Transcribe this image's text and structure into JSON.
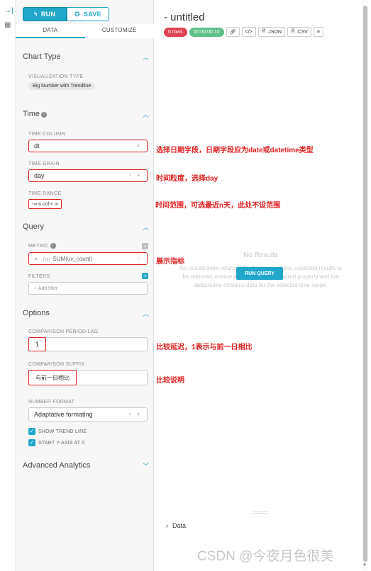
{
  "rail": {
    "collapse_icon": "→|",
    "grid_icon": "▦"
  },
  "toolbar": {
    "run_label": "RUN",
    "save_label": "SAVE",
    "run_icon": "bolt-icon",
    "save_icon": "save-icon"
  },
  "tabs": [
    {
      "label": "DATA",
      "active": true
    },
    {
      "label": "CUSTOMIZE",
      "active": false
    }
  ],
  "chart_type": {
    "section_title": "Chart Type",
    "viz_label": "VISUALIZATION TYPE",
    "viz_value": "Big Number with Trendline"
  },
  "time": {
    "section_title": "Time",
    "column_label": "TIME COLUMN",
    "column_value": "dt",
    "grain_label": "TIME GRAIN",
    "grain_value": "day",
    "range_label": "TIME RANGE",
    "range_value": "-∞ ≤ col < ∞"
  },
  "query": {
    "section_title": "Query",
    "metric_label": "METRIC",
    "metric_value": "SUM(uv_count)",
    "metric_fn_icon": "ƒ(x)",
    "filters_label": "FILTERS",
    "add_filter": "+ Add filter"
  },
  "options": {
    "section_title": "Options",
    "lag_label": "COMPARISON PERIOD LAG",
    "lag_value": "1",
    "suffix_label": "COMPARISON SUFFIX",
    "suffix_value": "与前一日相比",
    "format_label": "NUMBER FORMAT",
    "format_value": "Adaptative formating",
    "show_trend_line": "SHOW TREND LINE",
    "start_y_axis": "START Y-AXIS AT 0",
    "show_trend_line_checked": true,
    "start_y_axis_checked": true
  },
  "advanced": {
    "section_title": "Advanced Analytics"
  },
  "annotations": {
    "time_column": "选择日期字段，日期字段应为date或datetime类型",
    "time_grain": "时间粒度，选择day",
    "time_range": "时间范围，可选最近n天，此处不设范围",
    "metric": "展示指标",
    "lag": "比较延迟，1表示与前一日相比",
    "suffix": "比较说明"
  },
  "main": {
    "title": "- untitled",
    "rows_chip": "0 rows",
    "time_chip": "00:00:00.10",
    "json_label": ".JSON",
    "csv_label": ".CSV",
    "no_results_title": "No Results",
    "no_results_text": "No results were returned for this query. If you expected results to be returned, ensure any filters are configured property and the datasource contains data for the selected time range.",
    "run_query": "RUN QUERY",
    "data_label": "Data"
  },
  "colors": {
    "accent": "#20a7c9",
    "annotation_red": "#e02020",
    "rows_chip": "#e04355",
    "time_chip": "#5ac189"
  },
  "watermark": "CSDN @今夜月色很美"
}
